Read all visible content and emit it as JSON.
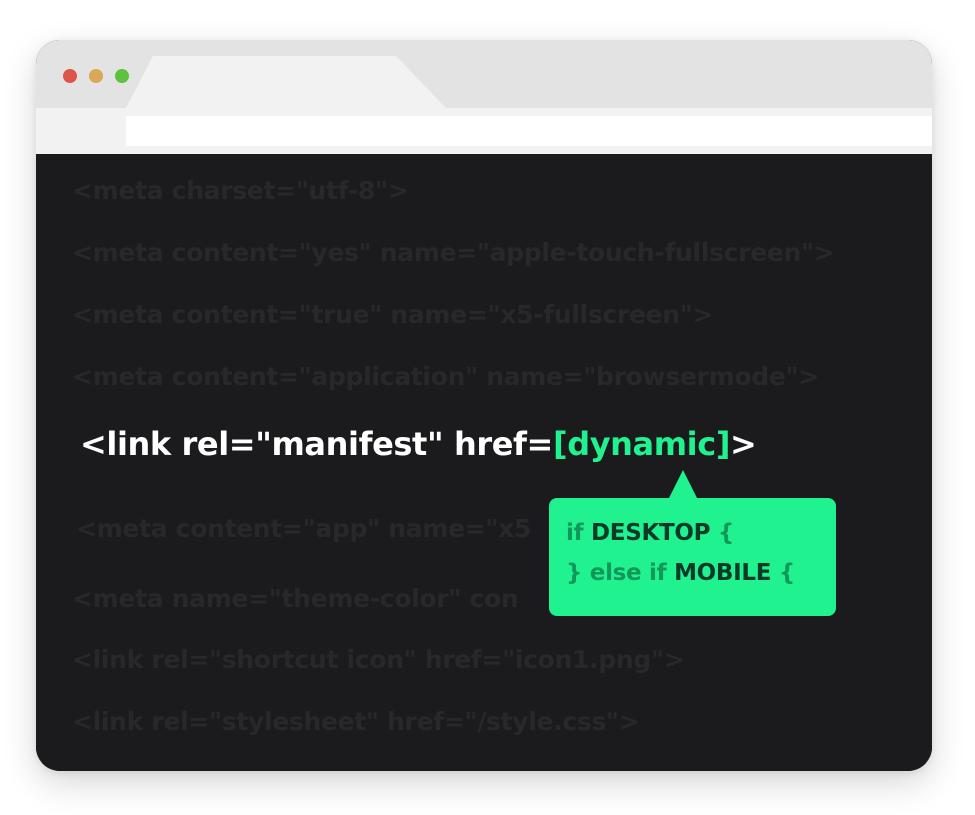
{
  "window": {
    "controls": {
      "close_color": "#e0554a",
      "minimize_color": "#dba85a",
      "maximize_color": "#5ec13f"
    },
    "tab_label": "",
    "address": ""
  },
  "code": {
    "lines_before": [
      "<meta charset=\"utf-8\">",
      "<meta content=\"yes\" name=\"apple-touch-fullscreen\">",
      "<meta content=\"true\" name=\"x5-fullscreen\">",
      "<meta content=\"application\" name=\"browsermode\">"
    ],
    "focus_line": {
      "prefix": "<link rel=\"manifest\" href=",
      "dynamic": "[dynamic]",
      "suffix": ">"
    },
    "lines_after": [
      "<meta content=\"app\" name=\"x5",
      "<meta name=\"theme-color\" con",
      "<link rel=\"shortcut icon\" href=\"icon1.png\">",
      "<link rel=\"stylesheet\" href=\"/style.css\">"
    ]
  },
  "tooltip": {
    "line1": {
      "text": "if ",
      "keyword": "DESKTOP",
      "brace": " {"
    },
    "line2": {
      "text": "} else if ",
      "keyword": "MOBILE",
      "brace": " {"
    }
  },
  "colors": {
    "accent": "#1ff28f",
    "editor_bg": "#1b1b1e",
    "dim_text": "#28282b"
  }
}
